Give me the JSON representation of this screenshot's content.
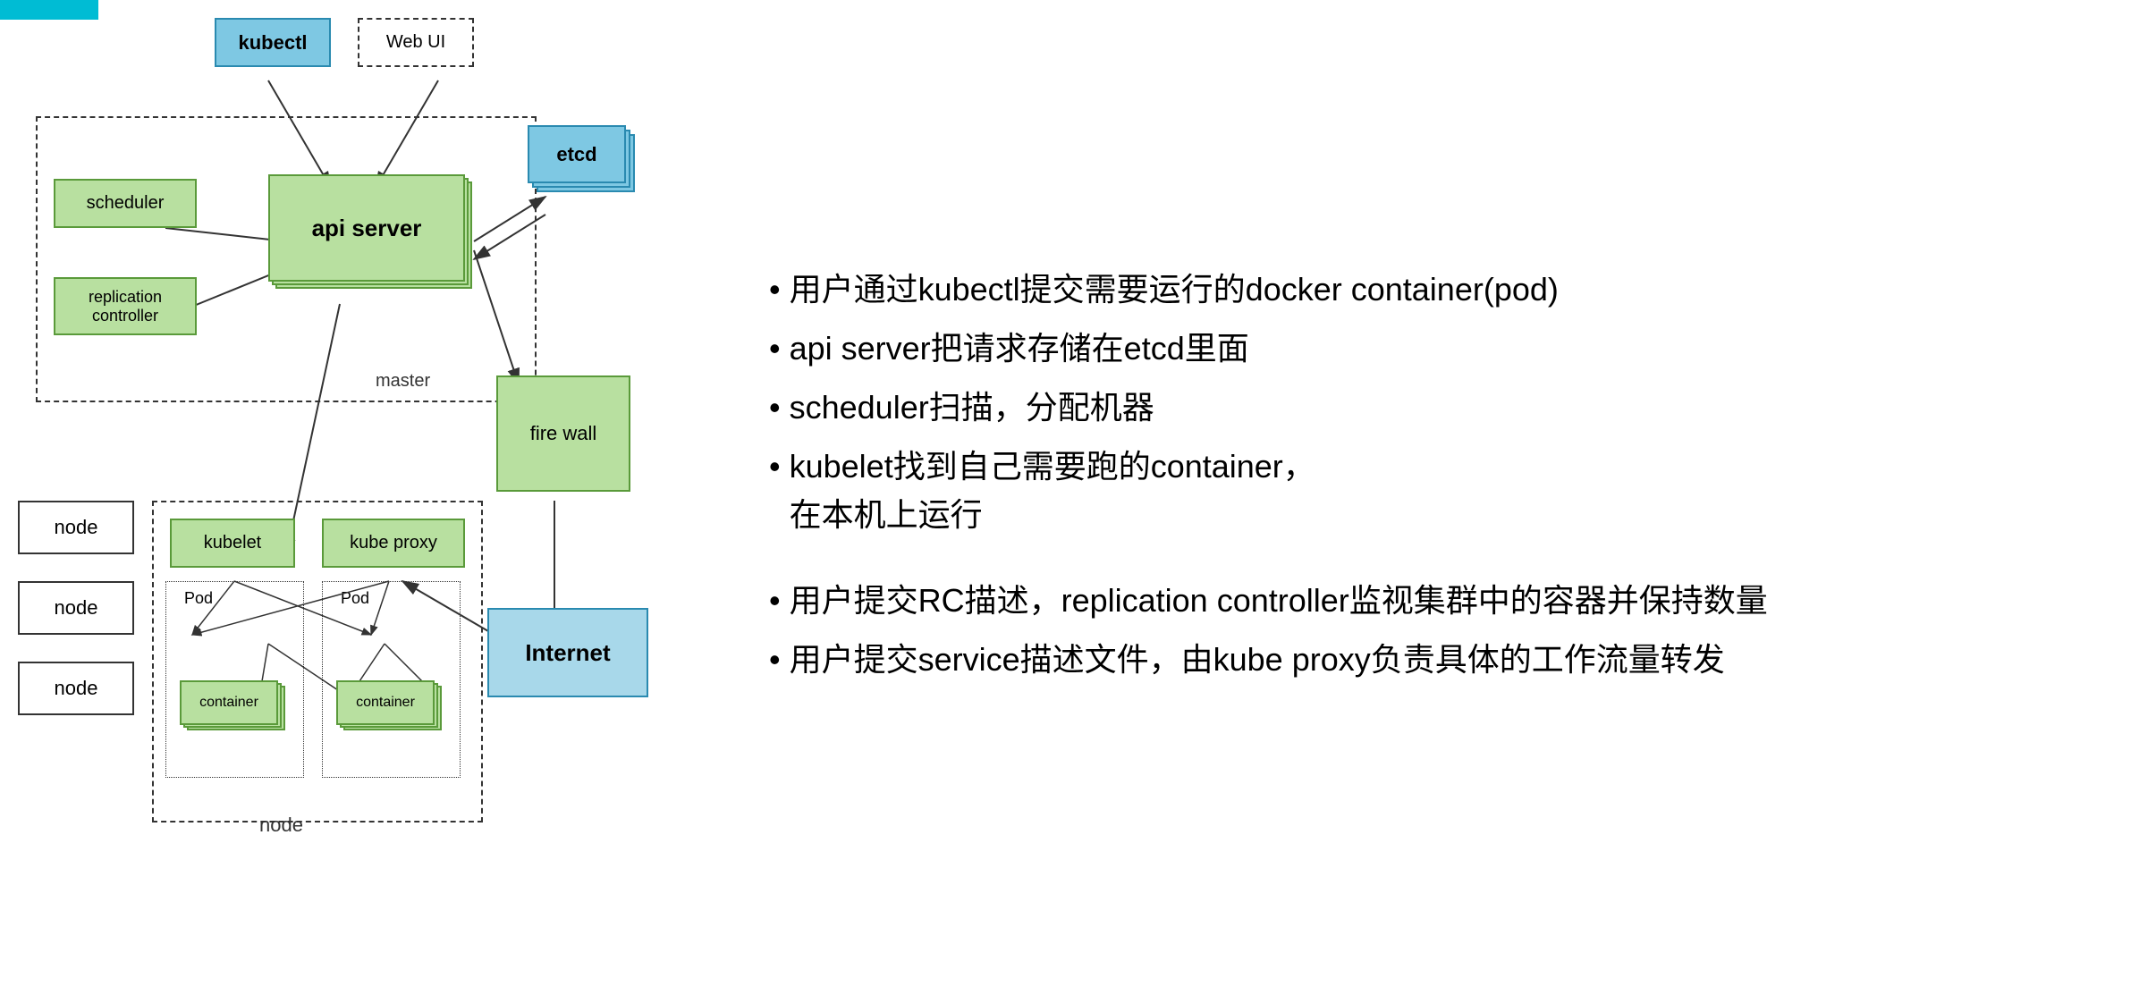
{
  "diagram": {
    "kubectl_label": "kubectl",
    "webui_label": "Web UI",
    "scheduler_label": "scheduler",
    "api_server_label": "api server",
    "etcd_label": "etcd",
    "replication_controller_label": "replication\ncontroller",
    "master_label": "master",
    "firewall_label": "fire wall",
    "node_labels": [
      "node",
      "node",
      "node"
    ],
    "kubelet_label": "kubelet",
    "kube_proxy_label": "kube proxy",
    "pod_label1": "Pod",
    "pod_label2": "Pod",
    "container_label1": "container",
    "container_label2": "container",
    "node_bottom_label": "node",
    "internet_label": "Internet"
  },
  "bullets": [
    {
      "text": "用户通过kubectl提交需要运行的docker container(pod)"
    },
    {
      "text": "api server把请求存储在etcd里面"
    },
    {
      "text": "scheduler扫描，分配机器"
    },
    {
      "text": "kubelet找到自己需要跑的container，\n在本机上运行"
    },
    {
      "text": "用户提交RC描述，replication controller监视集群中的容器并保持数量"
    },
    {
      "text": "用户提交service描述文件，由kube proxy负责具体的工作流量转发"
    }
  ]
}
